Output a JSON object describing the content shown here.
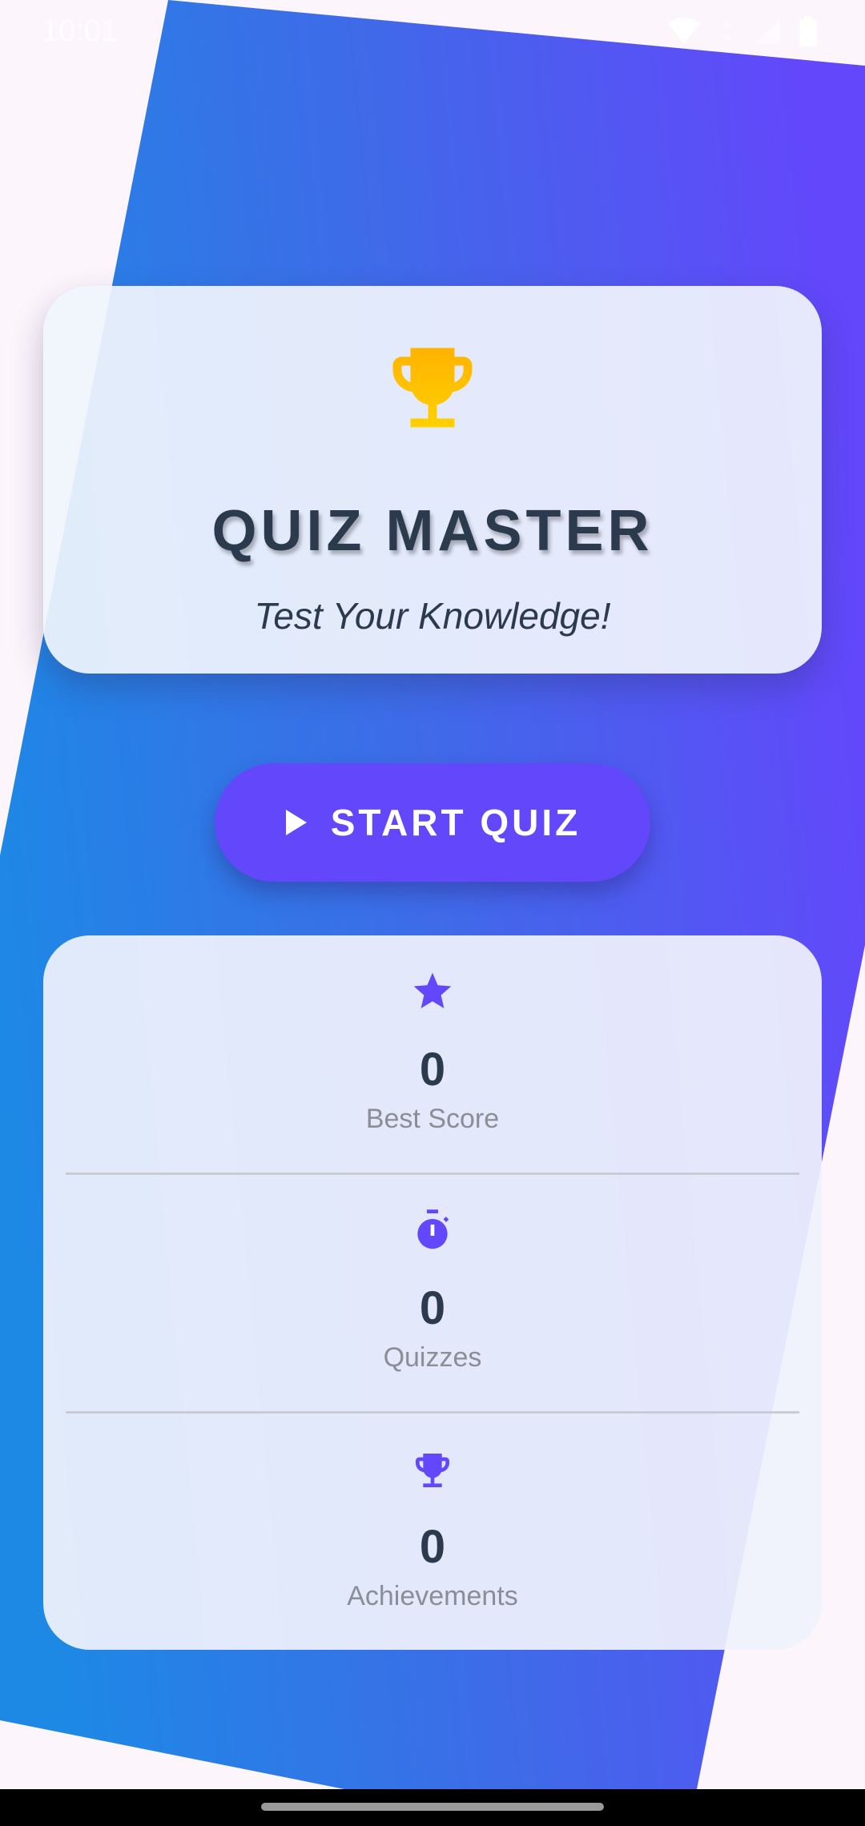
{
  "status_bar": {
    "time": "10:01",
    "icons": [
      "wifi-icon",
      "data-icon",
      "signal-icon",
      "battery-icon"
    ]
  },
  "colors": {
    "background": "#FCF5FB",
    "gradient_start": "#1E88E5",
    "gradient_end": "#6347FB",
    "accent": "#6347FB",
    "trophy": "#FFC107",
    "title_text": "#2C3A4D",
    "muted_text": "#8A8E96"
  },
  "hero": {
    "icon": "trophy-icon",
    "title": "QUIZ MASTER",
    "subtitle": "Test Your Knowledge!"
  },
  "start_button": {
    "icon": "play-icon",
    "label": "START QUIZ"
  },
  "stats": [
    {
      "icon": "star-icon",
      "value": "0",
      "label": "Best Score"
    },
    {
      "icon": "stopwatch-icon",
      "value": "0",
      "label": "Quizzes"
    },
    {
      "icon": "trophy-icon",
      "value": "0",
      "label": "Achievements"
    }
  ]
}
